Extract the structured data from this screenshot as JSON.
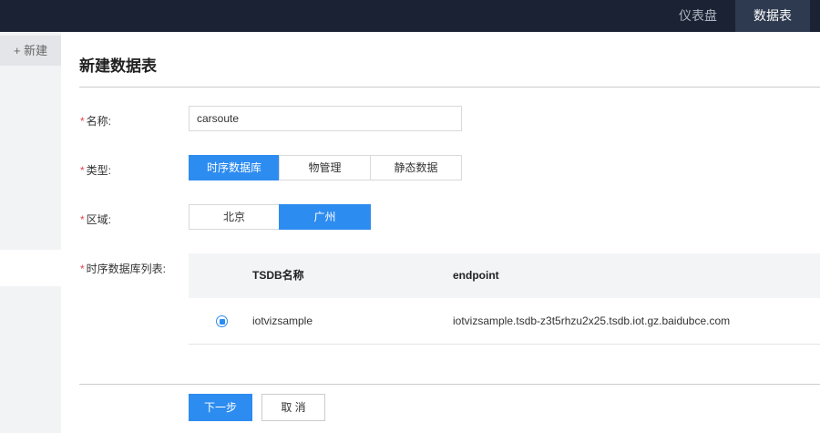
{
  "topnav": {
    "dashboard": "仪表盘",
    "datatable": "数据表"
  },
  "sidebar": {
    "new_label": "+ 新建"
  },
  "page": {
    "title": "新建数据表"
  },
  "form": {
    "required_mark": "*",
    "name": {
      "label": "名称:",
      "value": "carsoute"
    },
    "type": {
      "label": "类型:",
      "options": [
        "时序数据库",
        "物管理",
        "静态数据"
      ],
      "selected": "时序数据库"
    },
    "region": {
      "label": "区域:",
      "options": [
        "北京",
        "广州"
      ],
      "selected": "广州"
    },
    "tsdb_list": {
      "label": "时序数据库列表:",
      "columns": [
        "TSDB名称",
        "endpoint"
      ],
      "rows": [
        {
          "selected": true,
          "name": "iotvizsample",
          "endpoint": "iotvizsample.tsdb-z3t5rhzu2x25.tsdb.iot.gz.baidubce.com"
        }
      ]
    }
  },
  "actions": {
    "next": "下一步",
    "cancel": "取 消"
  },
  "colors": {
    "accent": "#2d8cf0",
    "topbar": "#1a2233",
    "required": "#e64552"
  }
}
